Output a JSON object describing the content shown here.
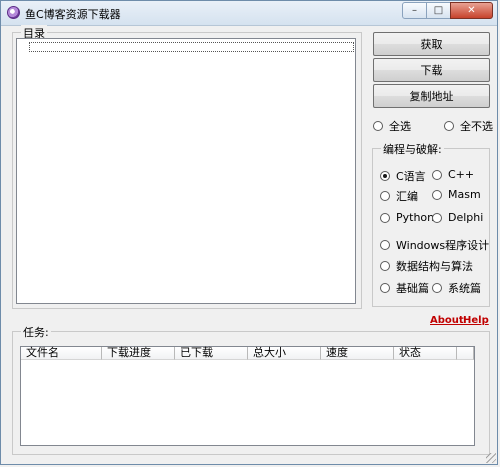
{
  "window": {
    "title": "鱼C博客资源下载器",
    "min_label": "–",
    "max_label": "□",
    "close_label": "✕"
  },
  "directory": {
    "label": "目录"
  },
  "buttons": {
    "fetch": "获取",
    "download": "下载",
    "copy_url": "复制地址"
  },
  "selection": {
    "select_all": "全选",
    "select_none": "全不选"
  },
  "category_group": {
    "label": "编程与破解:",
    "options": [
      {
        "label": "C语言",
        "selected": true
      },
      {
        "label": "C++",
        "selected": false
      },
      {
        "label": "汇编",
        "selected": false
      },
      {
        "label": "Masm",
        "selected": false
      },
      {
        "label": "Python",
        "selected": false
      },
      {
        "label": "Delphi",
        "selected": false
      },
      {
        "label": "Windows程序设计",
        "selected": false
      },
      {
        "label": "数据结构与算法",
        "selected": false
      },
      {
        "label": "基础篇",
        "selected": false
      },
      {
        "label": "系统篇",
        "selected": false
      }
    ]
  },
  "links": {
    "about": "About",
    "help": "Help"
  },
  "tasks": {
    "label": "任务:",
    "columns": [
      "文件名",
      "下载进度",
      "已下载",
      "总大小",
      "速度",
      "状态"
    ]
  }
}
